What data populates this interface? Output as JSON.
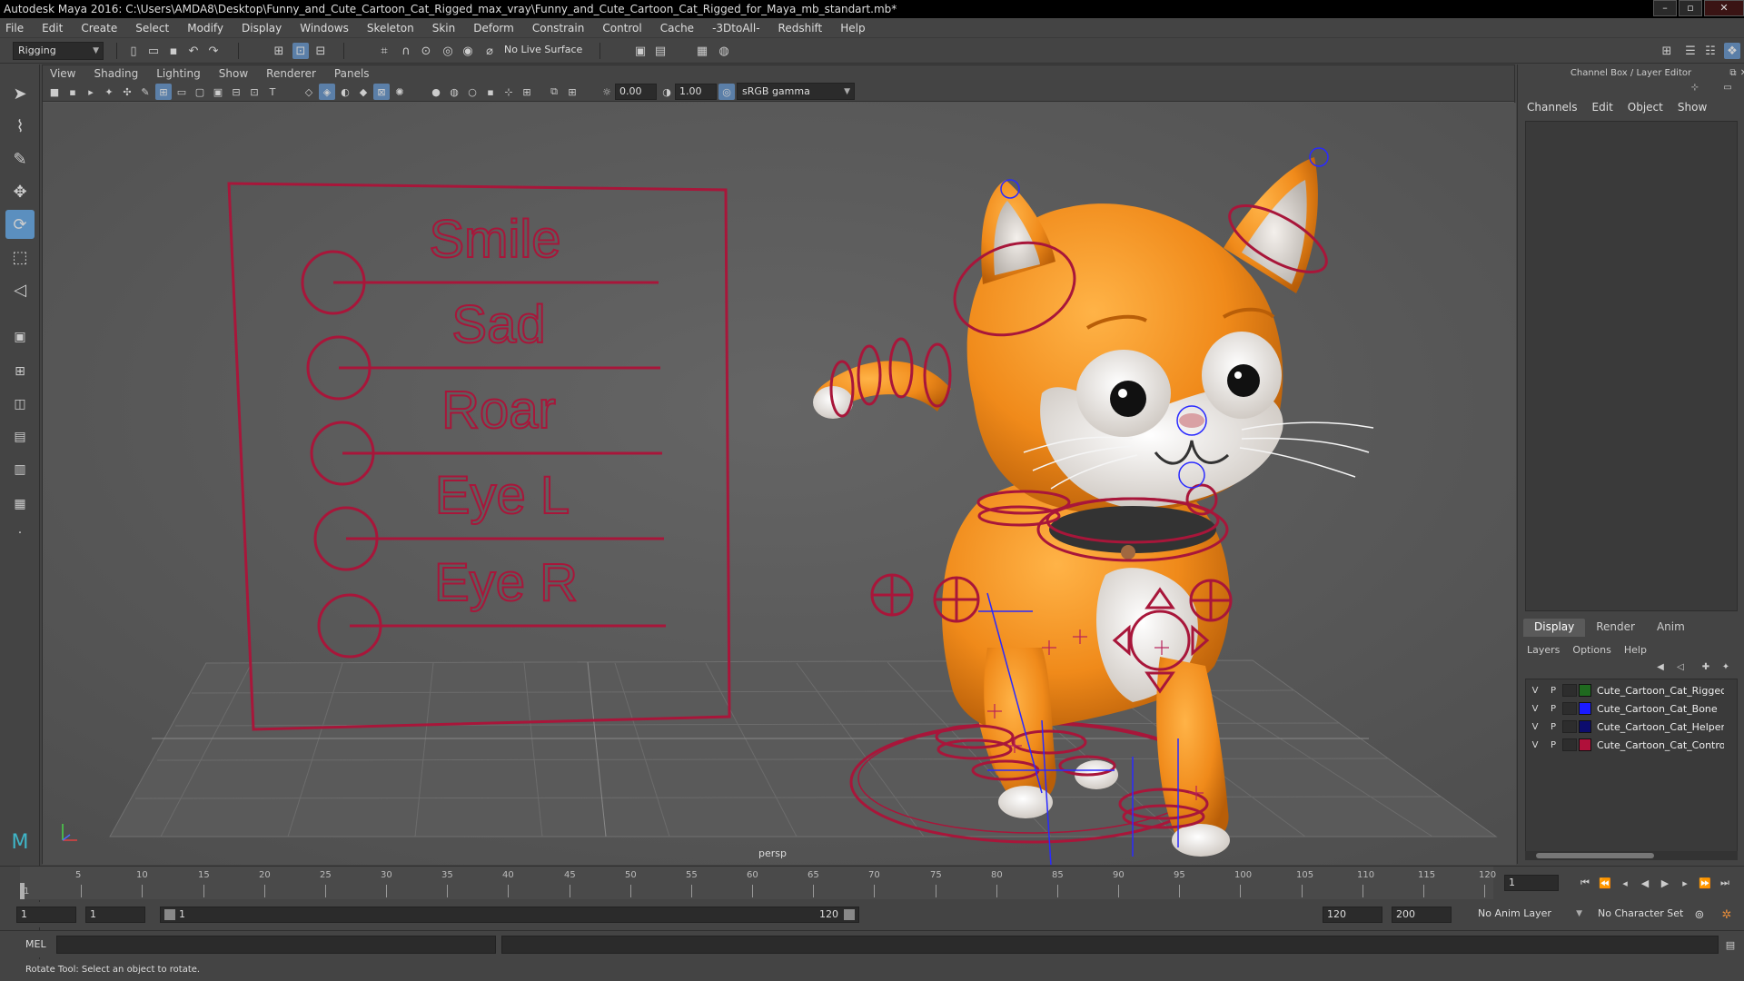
{
  "window": {
    "title": "Autodesk Maya 2016: C:\\Users\\AMDA8\\Desktop\\Funny_and_Cute_Cartoon_Cat_Rigged_max_vray\\Funny_and_Cute_Cartoon_Cat_Rigged_for_Maya_mb_standart.mb*"
  },
  "menubar": [
    "File",
    "Edit",
    "Create",
    "Select",
    "Modify",
    "Display",
    "Windows",
    "Skeleton",
    "Skin",
    "Deform",
    "Constrain",
    "Control",
    "Cache",
    "-3DtoAll-",
    "Redshift",
    "Help"
  ],
  "shelf": {
    "menu_set": "Rigging",
    "live_surface": "No Live Surface"
  },
  "viewport": {
    "menu": [
      "View",
      "Shading",
      "Lighting",
      "Show",
      "Renderer",
      "Panels"
    ],
    "exposure": "0.00",
    "gamma": "1.00",
    "color_space": "sRGB gamma",
    "camera_label": "persp",
    "face_board": {
      "labels": [
        "Smile",
        "Sad",
        "Roar",
        "Eye L",
        "Eye R"
      ],
      "color": "#a8163a"
    }
  },
  "channel_box": {
    "title": "Channel Box / Layer Editor",
    "menu": [
      "Channels",
      "Edit",
      "Object",
      "Show"
    ]
  },
  "layer_editor": {
    "tabs": [
      "Display",
      "Render",
      "Anim"
    ],
    "active_tab": "Display",
    "menu": [
      "Layers",
      "Options",
      "Help"
    ],
    "layers": [
      {
        "v": "V",
        "p": "P",
        "name": "Cute_Cartoon_Cat_Rigged",
        "color": "#1f6a1f"
      },
      {
        "v": "V",
        "p": "P",
        "name": "Cute_Cartoon_Cat_Bone",
        "color": "#1a1aff"
      },
      {
        "v": "V",
        "p": "P",
        "name": "Cute_Cartoon_Cat_Helpers",
        "color": "#0c0c6e"
      },
      {
        "v": "V",
        "p": "P",
        "name": "Cute_Cartoon_Cat_Controllers",
        "color": "#b0103a"
      }
    ]
  },
  "timeline": {
    "ticks": [
      "5",
      "10",
      "15",
      "20",
      "25",
      "30",
      "35",
      "40",
      "45",
      "50",
      "55",
      "60",
      "65",
      "70",
      "75",
      "80",
      "85",
      "90",
      "95",
      "100",
      "105",
      "110",
      "115",
      "120"
    ],
    "start_label": "1",
    "current_frame": "1"
  },
  "range": {
    "start": "1",
    "playback_start": "1",
    "slider_start": "1",
    "slider_end": "120",
    "playback_end": "120",
    "end": "200",
    "anim_layer": "No Anim Layer",
    "character_set": "No Character Set"
  },
  "command_line": {
    "language": "MEL"
  },
  "status": {
    "help_text": "Rotate Tool: Select an object to rotate."
  }
}
